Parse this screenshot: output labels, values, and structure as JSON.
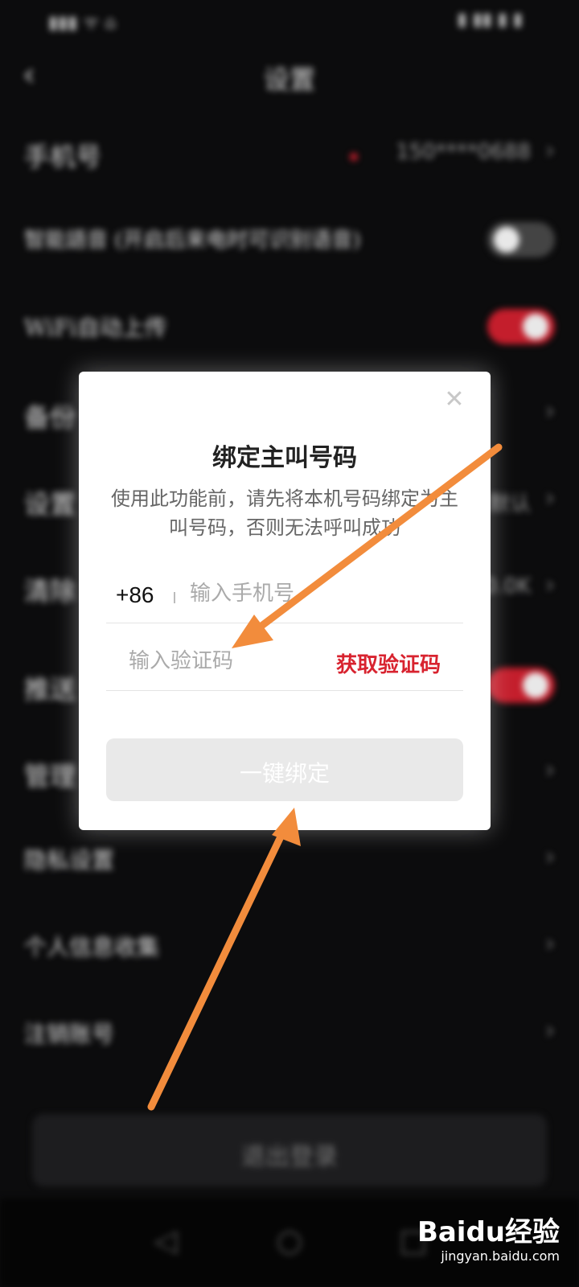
{
  "status_bar": {
    "left": "▮▮▮ ᯤ ⌂",
    "right": "▮ ▮▮ ▮ ▮"
  },
  "background_page": {
    "title": "设置",
    "rows": [
      {
        "label": "手机号",
        "value": "150****0688",
        "control": "chevron"
      },
      {
        "label": "智能語音 (开启后来电时可识别语音)",
        "value": "",
        "control": "toggle-off"
      },
      {
        "label": "WiFi自动上传",
        "value": "",
        "control": "toggle-on"
      },
      {
        "label": "备份",
        "value": "",
        "control": "chevron"
      },
      {
        "label": "设置",
        "value": "默认",
        "control": "chevron"
      },
      {
        "label": "清除",
        "value": "0.0K",
        "control": "chevron"
      },
      {
        "label": "推送",
        "value": "开",
        "control": "toggle-on"
      },
      {
        "label": "管理",
        "value": "",
        "control": "chevron"
      },
      {
        "label": "隐私设置",
        "value": "",
        "control": "chevron"
      },
      {
        "label": "个人信息收集",
        "value": "",
        "control": "chevron"
      },
      {
        "label": "注销账号",
        "value": "",
        "control": "chevron"
      }
    ],
    "logout_label": "退出登录"
  },
  "dialog": {
    "title": "绑定主叫号码",
    "description": "使用此功能前，请先将本机号码绑定为主叫号码，否则无法呼叫成功",
    "country_code": "+86",
    "phone_placeholder": "输入手机号",
    "code_placeholder": "输入验证码",
    "get_code_label": "获取验证码",
    "bind_button_label": "一键绑定",
    "close_icon": "close-icon"
  },
  "nav_bar": {
    "icons": [
      "back-icon",
      "home-icon",
      "recent-apps-icon"
    ]
  },
  "watermark": {
    "logo": "Baidu经验",
    "url": "jingyan.baidu.com"
  },
  "colors": {
    "accent_red": "#d8232f",
    "arrow_orange": "#f28c3c",
    "background_dark": "#0c0c0d",
    "dialog_bg": "#ffffff",
    "disabled_button": "#e9e9e9"
  }
}
